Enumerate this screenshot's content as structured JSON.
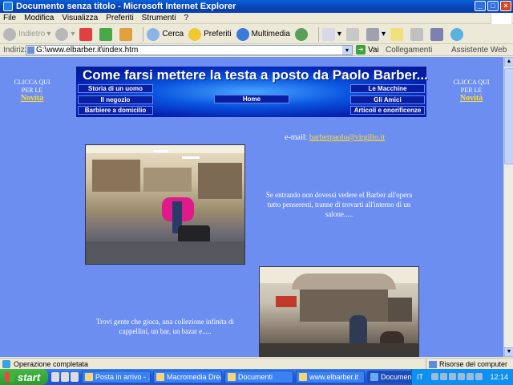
{
  "window": {
    "title": "Documento senza titolo - Microsoft Internet Explorer"
  },
  "menu": [
    "File",
    "Modifica",
    "Visualizza",
    "Preferiti",
    "Strumenti",
    "?"
  ],
  "toolbar": {
    "back": "Indietro",
    "search": "Cerca",
    "favorites": "Preferiti",
    "multimedia": "Multimedia"
  },
  "address": {
    "label": "Indirizzo",
    "url": "G:\\www.elbarber.it\\index.htm",
    "go": "Vai",
    "links": "Collegamenti",
    "assistant": "Assistente Web"
  },
  "page": {
    "left_promo": {
      "line1": "CLICCA QUI",
      "line2": "PER LE",
      "link": "Novità"
    },
    "right_promo": {
      "line1": "CLICCA QUI",
      "line2": "PER LE",
      "link": "Novità"
    },
    "banner": {
      "title": "Come farsi mettere la testa a posto da Paolo Barber...",
      "left_buttons": [
        "Storia di un uomo",
        "Il negozio",
        "Barbiere a domicilio"
      ],
      "center_button": "Home",
      "right_buttons": [
        "Le Macchine",
        "Gli Amici",
        "Articoli e onorificenze"
      ]
    },
    "email_label": "e-mail:",
    "email_link": "barberpaolo@virgilio.it",
    "text1": "Se entrando non dovessi vedere el Barber all'opera tutto penseresti, tranne di trovarti all'interno di un salone.....",
    "text2": "Trovi gente che gioca, una collezione infinita di cappellini, un bar, un bazar e....."
  },
  "status": {
    "text": "Operazione completata",
    "zone": "Risorse del computer"
  },
  "taskbar": {
    "start": "start",
    "tasks": [
      "Posta in arrivo - ...",
      "Macromedia Drea...",
      "Documenti",
      "www.elbarber.it",
      "Documento senza..."
    ],
    "lang": "IT",
    "clock": "12:14"
  },
  "colors": {
    "page_bg": "#6c8ef0",
    "link_yellow": "#ffdd33",
    "banner_blue": "#0a1fa0"
  }
}
